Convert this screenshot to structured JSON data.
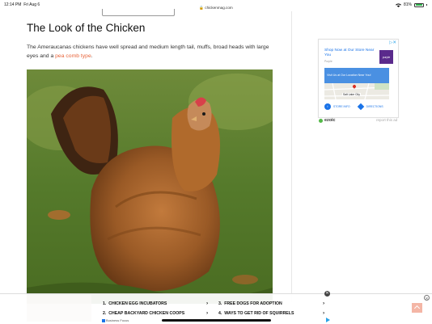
{
  "status_bar": {
    "time": "12:14 PM",
    "date": "Fri Aug 6",
    "url": "chickenmag.com",
    "battery": "81%"
  },
  "article": {
    "title": "The Look of the Chicken",
    "intro_text": "The Ameraucanas chickens have well spread and medium length tail, muffs, broad heads with large eyes and a ",
    "intro_link": "pea comb type",
    "intro_end": "."
  },
  "side_ad": {
    "headline": "Shop Now at Our Store Near You",
    "sub": "Purple",
    "logo_text": "purple",
    "cta": "Visit Us at Our Location Near You!",
    "map_city": "Salt Lake City",
    "store_info": "STORE INFO",
    "directions": "DIRECTIONS",
    "brand": "ezoic",
    "report": "report this ad"
  },
  "bottom_ad": {
    "links": [
      {
        "number": "1.",
        "label": "CHICKEN EGG INCUBATORS"
      },
      {
        "number": "3.",
        "label": "FREE DOGS FOR ADOPTION"
      },
      {
        "number": "2.",
        "label": "CHEAP BACKYARD CHICKEN COOPS"
      },
      {
        "number": "4.",
        "label": "WAYS TO GET RID OF SQUIRRELS"
      }
    ],
    "sponsor": "Business Focus",
    "close": "✕"
  },
  "colors": {
    "link": "#e8643a",
    "ad_blue": "#1a73e8",
    "ezoic_green": "#54b948"
  }
}
